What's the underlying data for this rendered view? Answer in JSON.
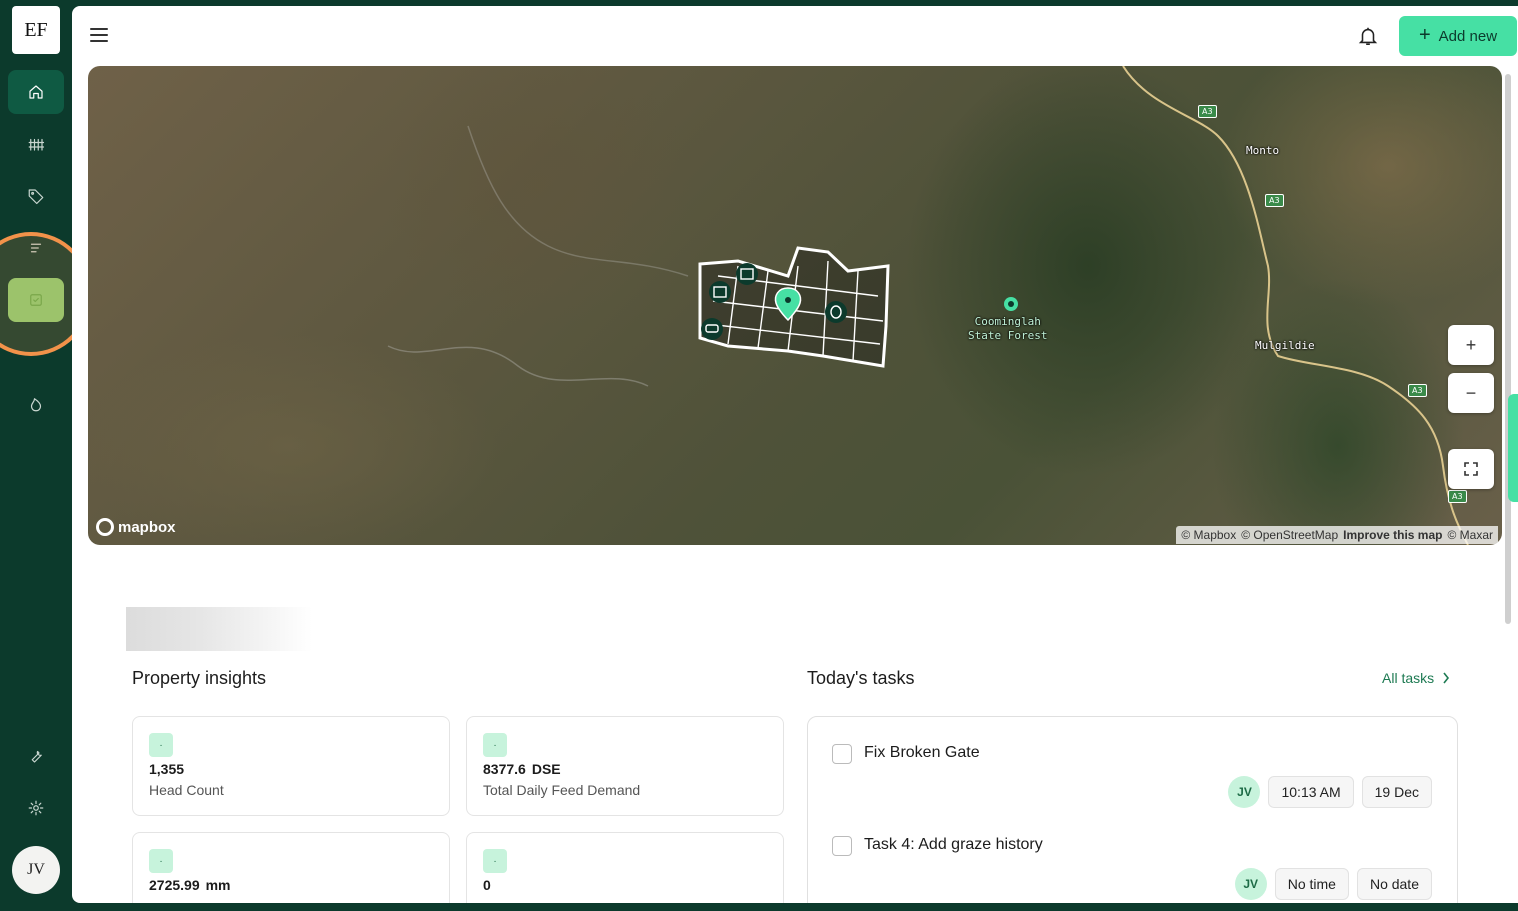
{
  "app": {
    "logo": "EF",
    "user_initials": "JV"
  },
  "header": {
    "add_new_label": "Add new"
  },
  "map": {
    "mapbox_brand": "mapbox",
    "attribution": {
      "mapbox": "© Mapbox",
      "osm": "© OpenStreetMap",
      "improve": "Improve this map",
      "maxar": "© Maxar"
    },
    "places": {
      "monto": "Monto",
      "mulgildie": "Mulgildie",
      "forest_line1": "Coominglah",
      "forest_line2": "State Forest"
    },
    "road_shield": "A3",
    "controls": {
      "zoom_in": "+",
      "zoom_out": "−"
    }
  },
  "insights": {
    "title": "Property insights",
    "cards": [
      {
        "badge": "·",
        "value": "1,355",
        "unit": "",
        "label": "Head Count"
      },
      {
        "badge": "·",
        "value": "8377.6",
        "unit": "DSE",
        "label": "Total Daily Feed Demand"
      },
      {
        "badge": "·",
        "value": "2725.99",
        "unit": "mm",
        "label": ""
      },
      {
        "badge": "·",
        "value": "0",
        "unit": "",
        "label": ""
      }
    ]
  },
  "tasks": {
    "title": "Today's tasks",
    "all_tasks_label": "All tasks",
    "items": [
      {
        "title": "Fix Broken Gate",
        "assignee": "JV",
        "time": "10:13 AM",
        "date": "19 Dec"
      },
      {
        "title": "Task 4: Add graze history",
        "assignee": "JV",
        "time": "No time",
        "date": "No date"
      }
    ]
  },
  "colors": {
    "sidebar": "#0c3a2c",
    "accent": "#46e0a4",
    "highlight_ring": "#f2924a"
  }
}
